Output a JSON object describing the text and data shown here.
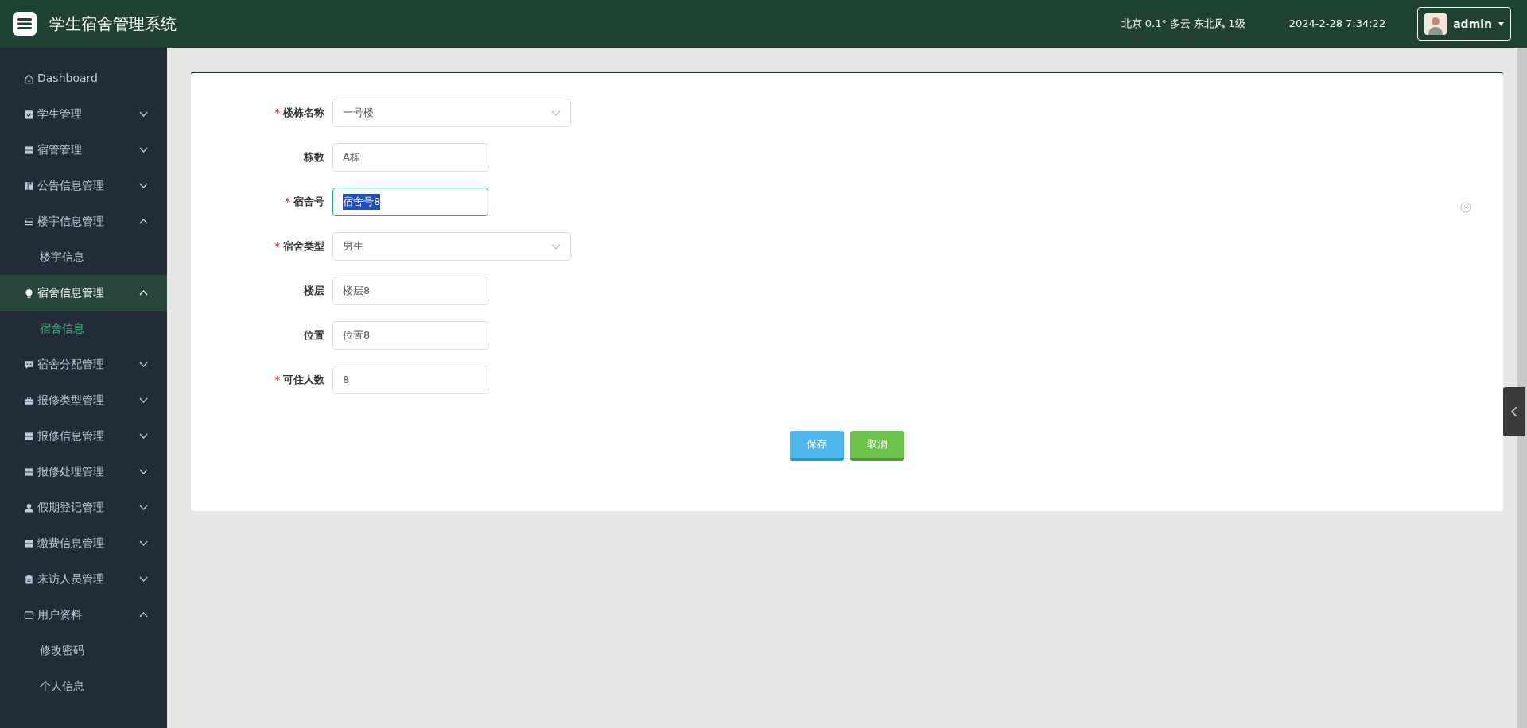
{
  "header": {
    "title": "学生宿舍管理系统",
    "weather": "北京  0.1°  多云  东北风  1级",
    "datetime": "2024-2-28 7:34:22",
    "user": "admin"
  },
  "sidebar": {
    "items": [
      {
        "label": "Dashboard",
        "selected": false
      },
      {
        "label": "学生管理",
        "expanded": false,
        "selected": false
      },
      {
        "label": "宿管管理",
        "expanded": false,
        "selected": false
      },
      {
        "label": "公告信息管理",
        "expanded": false,
        "selected": false
      },
      {
        "label": "楼宇信息管理",
        "expanded": true,
        "selected": false,
        "children": [
          {
            "label": "楼宇信息",
            "selected": false
          }
        ]
      },
      {
        "label": "宿舍信息管理",
        "expanded": true,
        "selected": true,
        "children": [
          {
            "label": "宿舍信息",
            "selected": true
          }
        ]
      },
      {
        "label": "宿舍分配管理",
        "expanded": false,
        "selected": false
      },
      {
        "label": "报修类型管理",
        "expanded": false,
        "selected": false
      },
      {
        "label": "报修信息管理",
        "expanded": false,
        "selected": false
      },
      {
        "label": "报修处理管理",
        "expanded": false,
        "selected": false
      },
      {
        "label": "假期登记管理",
        "expanded": false,
        "selected": false
      },
      {
        "label": "缴费信息管理",
        "expanded": false,
        "selected": false
      },
      {
        "label": "来访人员管理",
        "expanded": false,
        "selected": false
      },
      {
        "label": "用户资料",
        "expanded": true,
        "selected": false,
        "children": [
          {
            "label": "修改密码",
            "selected": false
          },
          {
            "label": "个人信息",
            "selected": false
          }
        ]
      }
    ]
  },
  "form": {
    "fields": [
      {
        "label": "楼栋名称",
        "required_mark": "*",
        "kind": "select",
        "value": "一号楼",
        "focused": false
      },
      {
        "label": "栋数",
        "kind": "text",
        "value": "A栋",
        "focused": false
      },
      {
        "label": "宿舍号",
        "required_mark": "*",
        "kind": "text",
        "value": "宿舍号8",
        "focused": true
      },
      {
        "label": "宿舍类型",
        "required_mark": "*",
        "kind": "select",
        "value": "男生",
        "focused": false
      },
      {
        "label": "楼层",
        "kind": "text",
        "value": "楼层8",
        "focused": false
      },
      {
        "label": "位置",
        "kind": "text",
        "value": "位置8",
        "focused": false
      },
      {
        "label": "可住人数",
        "required_mark": "*",
        "kind": "text",
        "value": "8",
        "focused": false
      }
    ],
    "buttons": [
      {
        "label": "保存",
        "kind": "save"
      },
      {
        "label": "取消",
        "kind": "cancel"
      }
    ]
  }
}
